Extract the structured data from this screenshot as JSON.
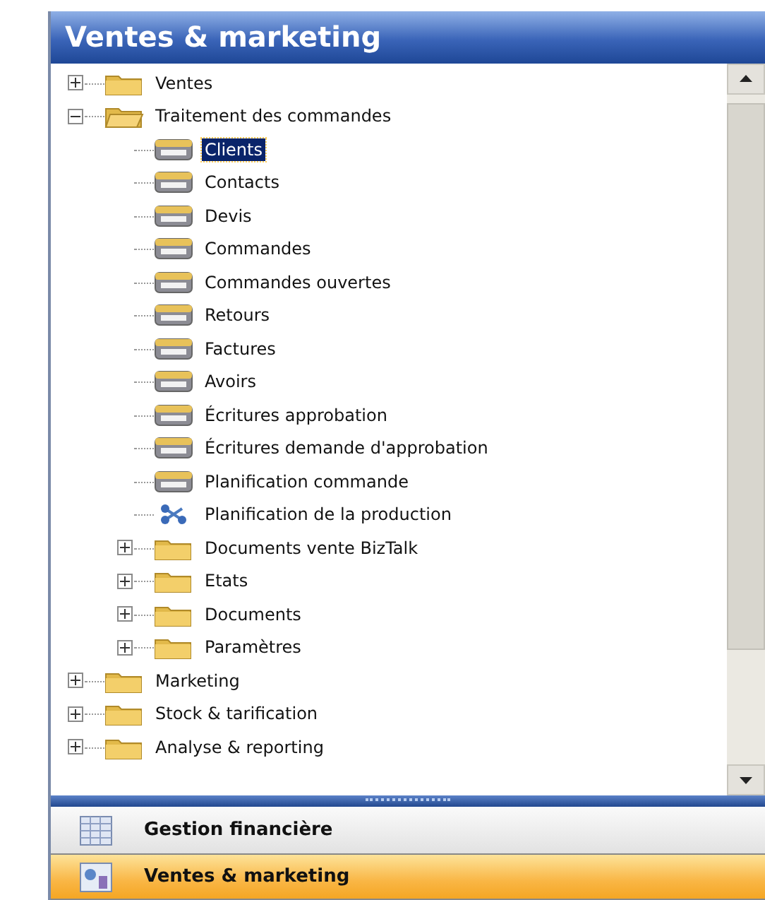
{
  "panel": {
    "title": "Ventes & marketing"
  },
  "tree": [
    {
      "label": "Ventes",
      "kind": "folder",
      "expanded": false,
      "selected": false
    },
    {
      "label": "Traitement des commandes",
      "kind": "folder",
      "expanded": true,
      "selected": false,
      "children": [
        {
          "label": "Clients",
          "kind": "form",
          "selected": true
        },
        {
          "label": "Contacts",
          "kind": "form",
          "selected": false
        },
        {
          "label": "Devis",
          "kind": "form",
          "selected": false
        },
        {
          "label": "Commandes",
          "kind": "form",
          "selected": false
        },
        {
          "label": "Commandes ouvertes",
          "kind": "form",
          "selected": false
        },
        {
          "label": "Retours",
          "kind": "form",
          "selected": false
        },
        {
          "label": "Factures",
          "kind": "form",
          "selected": false
        },
        {
          "label": "Avoirs",
          "kind": "form",
          "selected": false
        },
        {
          "label": "Écritures approbation",
          "kind": "form",
          "selected": false
        },
        {
          "label": "Écritures demande d'approbation",
          "kind": "form",
          "selected": false
        },
        {
          "label": "Planification commande",
          "kind": "form",
          "selected": false
        },
        {
          "label": "Planification de la production",
          "kind": "diagram",
          "selected": false
        },
        {
          "label": "Documents vente BizTalk",
          "kind": "folder",
          "expanded": false,
          "selected": false
        },
        {
          "label": "Etats",
          "kind": "folder",
          "expanded": false,
          "selected": false
        },
        {
          "label": "Documents",
          "kind": "folder",
          "expanded": false,
          "selected": false
        },
        {
          "label": "Paramètres",
          "kind": "folder",
          "expanded": false,
          "selected": false
        }
      ]
    },
    {
      "label": "Marketing",
      "kind": "folder",
      "expanded": false,
      "selected": false
    },
    {
      "label": "Stock & tarification",
      "kind": "folder",
      "expanded": false,
      "selected": false
    },
    {
      "label": "Analyse & reporting",
      "kind": "folder",
      "expanded": false,
      "selected": false
    }
  ],
  "nav_buttons": [
    {
      "label": "Gestion financière",
      "kind": "finance",
      "selected": false
    },
    {
      "label": "Ventes & marketing",
      "kind": "sales",
      "selected": true
    }
  ]
}
